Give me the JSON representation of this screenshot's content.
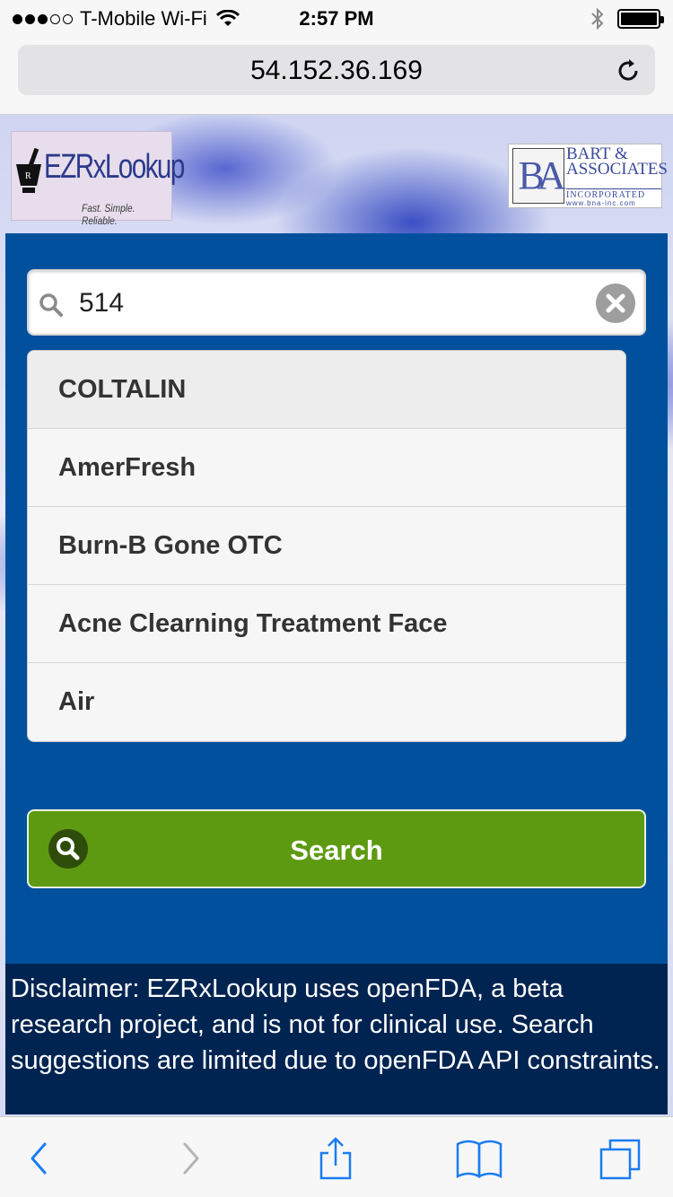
{
  "status_bar": {
    "carrier": "T-Mobile Wi-Fi",
    "time": "2:57 PM",
    "signal_bars_filled": 3,
    "signal_bars_total": 5
  },
  "browser": {
    "url": "54.152.36.169"
  },
  "logos": {
    "ez_title": "EZRxLookup",
    "ez_tagline": "Fast. Simple. Reliable.",
    "ba_monogram": "BA",
    "ba_name_line1": "BART &",
    "ba_name_line2": "ASSOCIATES",
    "ba_inc": "INCORPORATED",
    "ba_web": "www.bna-inc.com"
  },
  "search": {
    "value": "514",
    "suggestions": [
      "COLTALIN",
      "AmerFresh",
      "Burn-B Gone OTC",
      "Acne Clearning Treatment Face",
      "Air"
    ],
    "button_label": "Search"
  },
  "disclaimer": "Disclaimer: EZRxLookup uses openFDA, a beta research project, and is not for clinical use. Search suggestions are limited due to openFDA API constraints.",
  "colors": {
    "panel_blue": "#00509e",
    "disclaimer_navy": "#002451",
    "search_green": "#5d9a12",
    "ios_blue": "#1a7cf2"
  },
  "icons": {
    "search": "magnifier-icon",
    "clear": "clear-circle-x-icon",
    "reload": "reload-icon",
    "back": "chevron-left-icon",
    "forward": "chevron-right-icon",
    "share": "share-icon",
    "bookmarks": "open-book-icon",
    "tabs": "tabs-icon"
  }
}
